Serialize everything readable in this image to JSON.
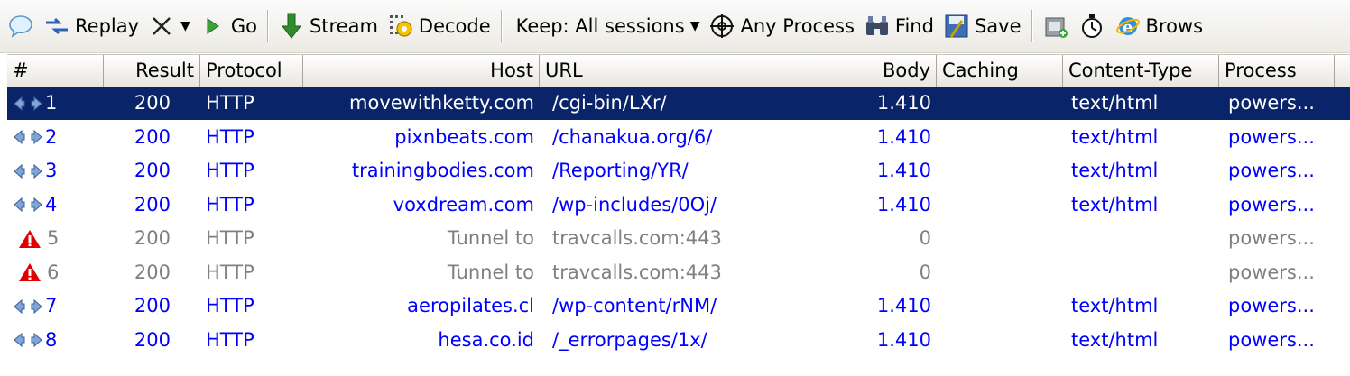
{
  "toolbar": {
    "replay_label": "Replay",
    "go_label": "Go",
    "stream_label": "Stream",
    "decode_label": "Decode",
    "keep_label": "Keep: All sessions",
    "process_label": "Any Process",
    "find_label": "Find",
    "save_label": "Save",
    "browse_label": "Brows"
  },
  "columns": {
    "num": "#",
    "result": "Result",
    "protocol": "Protocol",
    "host": "Host",
    "url": "URL",
    "body": "Body",
    "caching": "Caching",
    "content_type": "Content-Type",
    "process": "Process"
  },
  "sessions": [
    {
      "num": "1",
      "result": "200",
      "protocol": "HTTP",
      "host": "movewithketty.com",
      "url": "/cgi-bin/LXr/",
      "body": "1.410",
      "caching": "",
      "content_type": "text/html",
      "process": "powers...",
      "icon": "arrows-icon",
      "kind": "selected"
    },
    {
      "num": "2",
      "result": "200",
      "protocol": "HTTP",
      "host": "pixnbeats.com",
      "url": "/chanakua.org/6/",
      "body": "1.410",
      "caching": "",
      "content_type": "text/html",
      "process": "powers...",
      "icon": "arrows-icon",
      "kind": "normal"
    },
    {
      "num": "3",
      "result": "200",
      "protocol": "HTTP",
      "host": "trainingbodies.com",
      "url": "/Reporting/YR/",
      "body": "1.410",
      "caching": "",
      "content_type": "text/html",
      "process": "powers...",
      "icon": "arrows-icon",
      "kind": "normal"
    },
    {
      "num": "4",
      "result": "200",
      "protocol": "HTTP",
      "host": "voxdream.com",
      "url": "/wp-includes/0Oj/",
      "body": "1.410",
      "caching": "",
      "content_type": "text/html",
      "process": "powers...",
      "icon": "arrows-icon",
      "kind": "normal"
    },
    {
      "num": "5",
      "result": "200",
      "protocol": "HTTP",
      "host": "Tunnel to",
      "url": "travcalls.com:443",
      "body": "0",
      "caching": "",
      "content_type": "",
      "process": "powers...",
      "icon": "warning-icon",
      "kind": "tunnel"
    },
    {
      "num": "6",
      "result": "200",
      "protocol": "HTTP",
      "host": "Tunnel to",
      "url": "travcalls.com:443",
      "body": "0",
      "caching": "",
      "content_type": "",
      "process": "powers...",
      "icon": "warning-icon",
      "kind": "tunnel"
    },
    {
      "num": "7",
      "result": "200",
      "protocol": "HTTP",
      "host": "aeropilates.cl",
      "url": "/wp-content/rNM/",
      "body": "1.410",
      "caching": "",
      "content_type": "text/html",
      "process": "powers...",
      "icon": "arrows-icon",
      "kind": "normal"
    },
    {
      "num": "8",
      "result": "200",
      "protocol": "HTTP",
      "host": "hesa.co.id",
      "url": "/_errorpages/1x/",
      "body": "1.410",
      "caching": "",
      "content_type": "text/html",
      "process": "powers...",
      "icon": "arrows-icon",
      "kind": "normal"
    }
  ],
  "colors": {
    "selected_row": "#0a246a",
    "normal_text": "#0000ff",
    "tunnel_text": "#808080",
    "warning_icon": "#e00000"
  }
}
